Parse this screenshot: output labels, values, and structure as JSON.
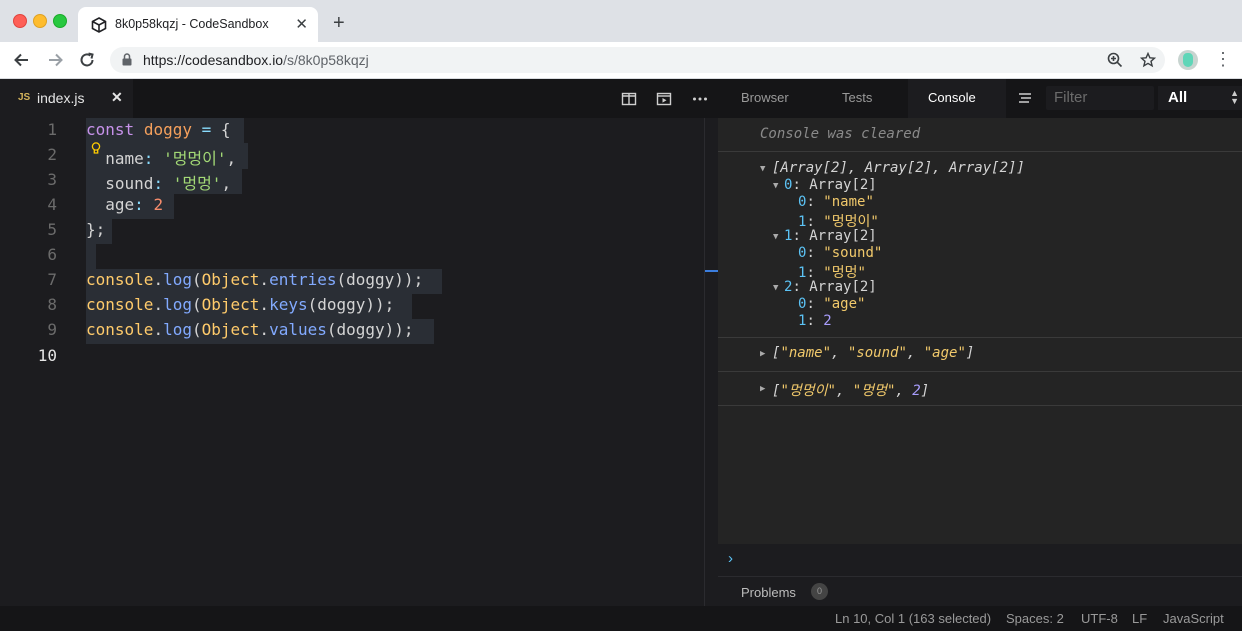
{
  "browser": {
    "tab_title": "8k0p58kqzj - CodeSandbox",
    "tab_close": "✕",
    "new_tab": "+",
    "url_host": "https://codesandbox.io",
    "url_path": "/s/8k0p58kqzj",
    "window_colors": {
      "close": "#fe5f57",
      "minimize": "#febc2e",
      "maximize": "#28c840"
    },
    "icons": [
      "back-arrow-icon",
      "forward-arrow-icon",
      "reload-icon",
      "lock-icon",
      "zoom-icon",
      "star-icon",
      "profile-icon",
      "kebab-menu-icon"
    ]
  },
  "editor": {
    "tab": {
      "badge": "JS",
      "filename": "index.js",
      "close": "✕"
    },
    "header_icons": [
      "split-view-icon",
      "preview-icon",
      "more-icon"
    ],
    "line_numbers": [
      "1",
      "2",
      "3",
      "4",
      "5",
      "6",
      "7",
      "8",
      "9",
      "10"
    ],
    "current_line": "10",
    "code": {
      "l1": {
        "kw": "const",
        "name": "doggy",
        "eq": "=",
        "brace": "{"
      },
      "l2": {
        "key": "name",
        "colon": ":",
        "val": "'멍멍이'",
        "comma": ","
      },
      "l3": {
        "key": "sound",
        "colon": ":",
        "val": "'멍멍'",
        "comma": ","
      },
      "l4": {
        "key": "age",
        "colon": ":",
        "val": "2"
      },
      "l5": {
        "close": "};"
      },
      "l7": {
        "obj": "console",
        "dot1": ".",
        "method": "log",
        "open": "(",
        "cls": "Object",
        "dot2": ".",
        "fn": "entries",
        "arg": "(doggy));"
      },
      "l8": {
        "obj": "console",
        "dot1": ".",
        "method": "log",
        "open": "(",
        "cls": "Object",
        "dot2": ".",
        "fn": "keys",
        "arg": "(doggy));"
      },
      "l9": {
        "obj": "console",
        "dot1": ".",
        "method": "log",
        "open": "(",
        "cls": "Object",
        "dot2": ".",
        "fn": "values",
        "arg": "(doggy));"
      }
    }
  },
  "devtools": {
    "tabs": [
      "Browser",
      "Tests",
      "Console"
    ],
    "active_tab": "Console",
    "filter_placeholder": "Filter",
    "level": "All",
    "cleared_message": "Console was cleared",
    "entries": {
      "e1_header": "[Array[2], Array[2], Array[2]]",
      "e1_items": [
        {
          "index": "0",
          "label": "Array[2]",
          "k0": "0",
          "v0": "\"name\"",
          "k1": "1",
          "v1": "\"멍멍이\""
        },
        {
          "index": "1",
          "label": "Array[2]",
          "k0": "0",
          "v0": "\"sound\"",
          "k1": "1",
          "v1": "\"멍멍\""
        },
        {
          "index": "2",
          "label": "Array[2]",
          "k0": "0",
          "v0": "\"age\"",
          "k1": "1",
          "v1": "2"
        }
      ],
      "e2": {
        "open": "[",
        "a": "\"name\"",
        "b": "\"sound\"",
        "c": "\"age\"",
        "close": "]",
        "sep": ", "
      },
      "e3": {
        "open": "[",
        "a": "\"멍멍이\"",
        "b": "\"멍멍\"",
        "c": "2",
        "close": "]",
        "sep": ", "
      }
    },
    "prompt": "›",
    "problems": {
      "label": "Problems",
      "count": "0"
    }
  },
  "statusbar": {
    "position": "Ln 10, Col 1 (163 selected)",
    "spaces": "Spaces: 2",
    "encoding": "UTF-8",
    "eol": "LF",
    "language": "JavaScript"
  }
}
